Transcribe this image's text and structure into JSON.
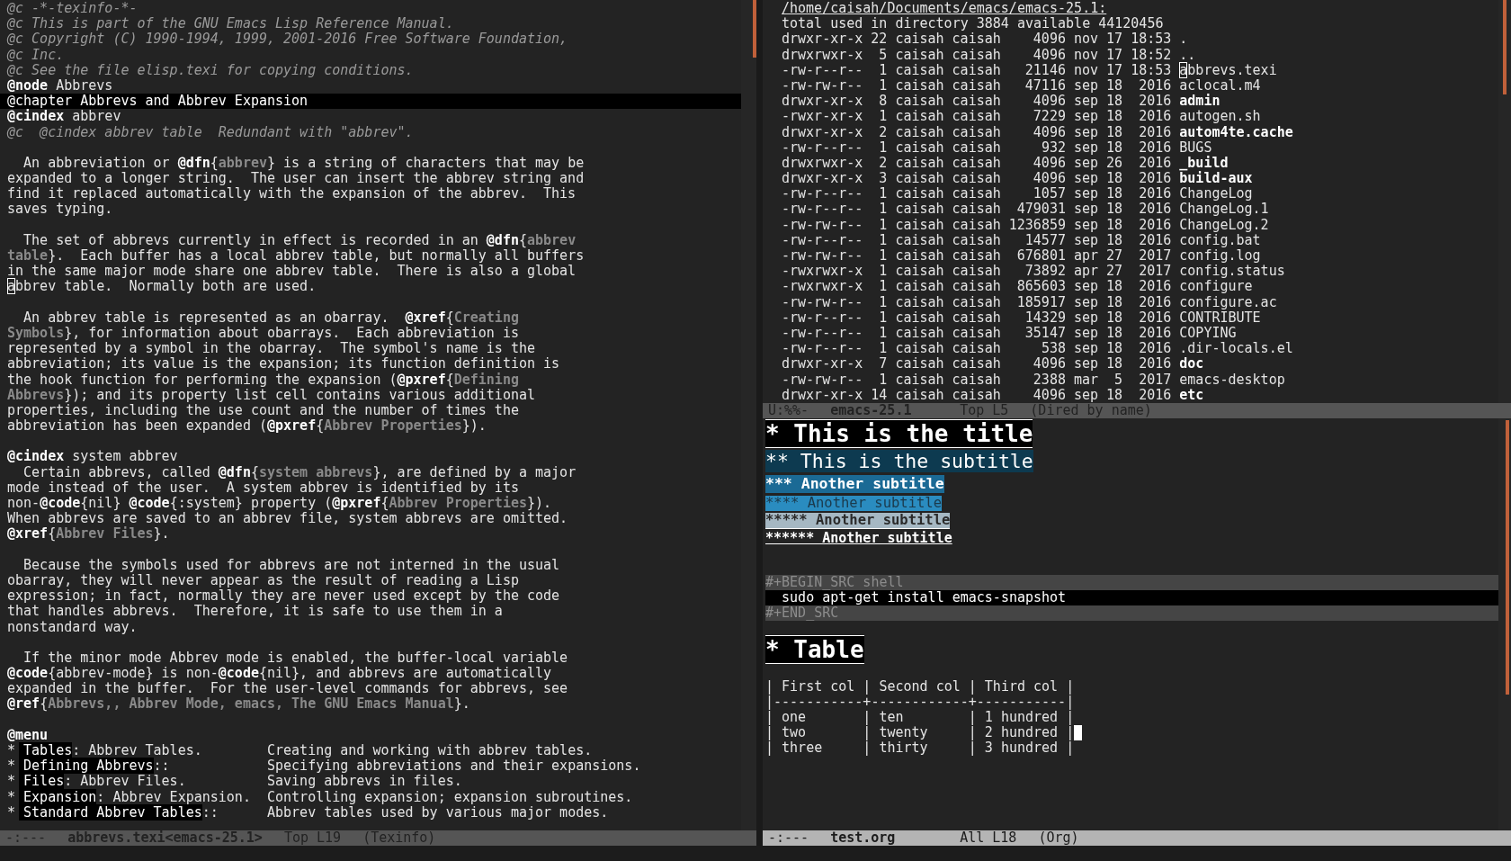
{
  "texinfo_buffer": {
    "blocks": [
      {
        "lines": [
          [
            {
              "kind": "comment",
              "text": "@c -*-texinfo-*-"
            }
          ],
          [
            {
              "kind": "comment",
              "text": "@c This is part of the GNU Emacs Lisp Reference Manual."
            }
          ],
          [
            {
              "kind": "comment",
              "text": "@c Copyright (C) 1990-1994, 1999, 2001-2016 Free Software Foundation,"
            }
          ],
          [
            {
              "kind": "comment",
              "text": "@c Inc."
            }
          ],
          [
            {
              "kind": "comment",
              "text": "@c See the file elisp.texi for copying conditions."
            }
          ],
          [
            {
              "kind": "keyword",
              "text": "@node"
            },
            {
              "kind": "text",
              "text": " Abbrevs"
            }
          ],
          [
            {
              "kind": "heading",
              "text": "@chapter Abbrevs and Abbrev Expansion"
            }
          ],
          [
            {
              "kind": "keyword",
              "text": "@cindex"
            },
            {
              "kind": "text",
              "text": " abbrev"
            }
          ],
          [
            {
              "kind": "comment",
              "text": "@c  @cindex abbrev table  Redundant with \"abbrev\"."
            }
          ]
        ]
      },
      {
        "lines": [
          [
            {
              "kind": "text",
              "text": "  An abbreviation or "
            },
            {
              "kind": "keyword",
              "text": "@dfn"
            },
            {
              "kind": "text",
              "text": "{"
            },
            {
              "kind": "ref",
              "text": "abbrev"
            },
            {
              "kind": "text",
              "text": "} is a string of characters that may be"
            }
          ],
          [
            {
              "kind": "text",
              "text": "expanded to a longer string.  The user can insert the abbrev string and"
            }
          ],
          [
            {
              "kind": "text",
              "text": "find it replaced automatically with the expansion of the abbrev.  This"
            }
          ],
          [
            {
              "kind": "text",
              "text": "saves typing."
            }
          ]
        ]
      },
      {
        "lines": [
          [
            {
              "kind": "text",
              "text": "  The set of abbrevs currently in effect is recorded in an "
            },
            {
              "kind": "keyword",
              "text": "@dfn"
            },
            {
              "kind": "text",
              "text": "{"
            },
            {
              "kind": "ref",
              "text": "abbrev"
            }
          ],
          [
            {
              "kind": "ref",
              "text": "table"
            },
            {
              "kind": "text",
              "text": "}.  Each buffer has a local abbrev table, but normally all buffers"
            }
          ],
          [
            {
              "kind": "text",
              "text": "in the same major mode share one abbrev table.  There is also a global"
            }
          ],
          [
            {
              "kind": "cursor",
              "text": "a"
            },
            {
              "kind": "text",
              "text": "bbrev table.  Normally both are used."
            }
          ]
        ]
      },
      {
        "lines": [
          [
            {
              "kind": "text",
              "text": "  An abbrev table is represented as an obarray.  "
            },
            {
              "kind": "keyword",
              "text": "@xref"
            },
            {
              "kind": "text",
              "text": "{"
            },
            {
              "kind": "ref",
              "text": "Creating"
            }
          ],
          [
            {
              "kind": "ref",
              "text": "Symbols"
            },
            {
              "kind": "text",
              "text": "}, for information about obarrays.  Each abbreviation is"
            }
          ],
          [
            {
              "kind": "text",
              "text": "represented by a symbol in the obarray.  The symbol's name is the"
            }
          ],
          [
            {
              "kind": "text",
              "text": "abbreviation; its value is the expansion; its function definition is"
            }
          ],
          [
            {
              "kind": "text",
              "text": "the hook function for performing the expansion ("
            },
            {
              "kind": "keyword",
              "text": "@pxref"
            },
            {
              "kind": "text",
              "text": "{"
            },
            {
              "kind": "ref",
              "text": "Defining"
            }
          ],
          [
            {
              "kind": "ref",
              "text": "Abbrevs"
            },
            {
              "kind": "text",
              "text": "}); and its property list cell contains various additional"
            }
          ],
          [
            {
              "kind": "text",
              "text": "properties, including the use count and the number of times the"
            }
          ],
          [
            {
              "kind": "text",
              "text": "abbreviation has been expanded ("
            },
            {
              "kind": "keyword",
              "text": "@pxref"
            },
            {
              "kind": "text",
              "text": "{"
            },
            {
              "kind": "ref",
              "text": "Abbrev Properties"
            },
            {
              "kind": "text",
              "text": "})."
            }
          ]
        ]
      },
      {
        "lines": [
          [
            {
              "kind": "keyword",
              "text": "@cindex"
            },
            {
              "kind": "text",
              "text": " system abbrev"
            }
          ],
          [
            {
              "kind": "text",
              "text": "  Certain abbrevs, called "
            },
            {
              "kind": "keyword",
              "text": "@dfn"
            },
            {
              "kind": "text",
              "text": "{"
            },
            {
              "kind": "ref",
              "text": "system abbrevs"
            },
            {
              "kind": "text",
              "text": "}, are defined by a major"
            }
          ],
          [
            {
              "kind": "text",
              "text": "mode instead of the user.  A system abbrev is identified by its"
            }
          ],
          [
            {
              "kind": "text",
              "text": "non-"
            },
            {
              "kind": "keyword",
              "text": "@code"
            },
            {
              "kind": "text",
              "text": "{nil} "
            },
            {
              "kind": "keyword",
              "text": "@code"
            },
            {
              "kind": "text",
              "text": "{:system} property ("
            },
            {
              "kind": "keyword",
              "text": "@pxref"
            },
            {
              "kind": "text",
              "text": "{"
            },
            {
              "kind": "ref",
              "text": "Abbrev Properties"
            },
            {
              "kind": "text",
              "text": "})."
            }
          ],
          [
            {
              "kind": "text",
              "text": "When abbrevs are saved to an abbrev file, system abbrevs are omitted."
            }
          ],
          [
            {
              "kind": "keyword",
              "text": "@xref"
            },
            {
              "kind": "text",
              "text": "{"
            },
            {
              "kind": "ref",
              "text": "Abbrev Files"
            },
            {
              "kind": "text",
              "text": "}."
            }
          ]
        ]
      },
      {
        "lines": [
          [
            {
              "kind": "text",
              "text": "  Because the symbols used for abbrevs are not interned in the usual"
            }
          ],
          [
            {
              "kind": "text",
              "text": "obarray, they will never appear as the result of reading a Lisp"
            }
          ],
          [
            {
              "kind": "text",
              "text": "expression; in fact, normally they are never used except by the code"
            }
          ],
          [
            {
              "kind": "text",
              "text": "that handles abbrevs.  Therefore, it is safe to use them in a"
            }
          ],
          [
            {
              "kind": "text",
              "text": "nonstandard way."
            }
          ]
        ]
      },
      {
        "lines": [
          [
            {
              "kind": "text",
              "text": "  If the minor mode Abbrev mode is enabled, the buffer-local variable"
            }
          ],
          [
            {
              "kind": "keyword",
              "text": "@code"
            },
            {
              "kind": "text",
              "text": "{abbrev-mode} is non-"
            },
            {
              "kind": "keyword",
              "text": "@code"
            },
            {
              "kind": "text",
              "text": "{nil}, and abbrevs are automatically"
            }
          ],
          [
            {
              "kind": "text",
              "text": "expanded in the buffer.  For the user-level commands for abbrevs, see"
            }
          ],
          [
            {
              "kind": "keyword",
              "text": "@ref"
            },
            {
              "kind": "text",
              "text": "{"
            },
            {
              "kind": "ref",
              "text": "Abbrevs,, Abbrev Mode, emacs, The GNU Emacs Manual"
            },
            {
              "kind": "text",
              "text": "}."
            }
          ]
        ]
      },
      {
        "lines": [
          [
            {
              "kind": "keyword",
              "text": "@menu"
            }
          ],
          [
            {
              "kind": "text",
              "text": "* "
            },
            {
              "kind": "menu-node",
              "text": "Tables"
            },
            {
              "kind": "text",
              "text": ": Abbrev Tables.        Creating and working with abbrev tables."
            }
          ],
          [
            {
              "kind": "text",
              "text": "* "
            },
            {
              "kind": "menu-node",
              "text": "Defining Abbrevs"
            },
            {
              "kind": "text",
              "text": "::            Specifying abbreviations and their expansions."
            }
          ],
          [
            {
              "kind": "text",
              "text": "* "
            },
            {
              "kind": "menu-node",
              "text": "Files"
            },
            {
              "kind": "text",
              "text": ": Abbrev Files.          Saving abbrevs in files."
            }
          ],
          [
            {
              "kind": "text",
              "text": "* "
            },
            {
              "kind": "menu-node",
              "text": "Expansion"
            },
            {
              "kind": "text",
              "text": ": Abbrev Expansion.  Controlling expansion; expansion subroutines."
            }
          ],
          [
            {
              "kind": "text",
              "text": "* "
            },
            {
              "kind": "menu-node",
              "text": "Standard Abbrev Tables"
            },
            {
              "kind": "text",
              "text": "::      Abbrev tables used by various major modes."
            }
          ]
        ]
      }
    ],
    "mode_line": {
      "active": false,
      "status": "-:---",
      "buffer": "abbrevs.texi<emacs-25.1>",
      "position": "Top L19",
      "mode": "(Texinfo)"
    }
  },
  "dired_buffer": {
    "header": "/home/caisah/Documents/emacs/emacs-25.1:",
    "total": "total used in directory 3884 available 44120456",
    "rows": [
      {
        "perms": "drwxr-xr-x",
        "links": "22",
        "owner": "caisah",
        "group": "caisah",
        "size": "4096",
        "month": "nov",
        "day": "17",
        "time": "18:53",
        "name": ".",
        "kind": "link",
        "cursor": false
      },
      {
        "perms": "drwxrwxr-x",
        "links": "5",
        "owner": "caisah",
        "group": "caisah",
        "size": "4096",
        "month": "nov",
        "day": "17",
        "time": "18:52",
        "name": "..",
        "kind": "link",
        "cursor": false
      },
      {
        "perms": "-rw-r--r--",
        "links": "1",
        "owner": "caisah",
        "group": "caisah",
        "size": "21146",
        "month": "nov",
        "day": "17",
        "time": "18:53",
        "name": "abbrevs.texi",
        "kind": "file",
        "cursor": true
      },
      {
        "perms": "-rw-rw-r--",
        "links": "1",
        "owner": "caisah",
        "group": "caisah",
        "size": "47116",
        "month": "sep",
        "day": "18",
        "time": "2016",
        "name": "aclocal.m4",
        "kind": "file",
        "cursor": false
      },
      {
        "perms": "drwxr-xr-x",
        "links": "8",
        "owner": "caisah",
        "group": "caisah",
        "size": "4096",
        "month": "sep",
        "day": "18",
        "time": "2016",
        "name": "admin",
        "kind": "dir",
        "cursor": false
      },
      {
        "perms": "-rwxr-xr-x",
        "links": "1",
        "owner": "caisah",
        "group": "caisah",
        "size": "7229",
        "month": "sep",
        "day": "18",
        "time": "2016",
        "name": "autogen.sh",
        "kind": "file",
        "cursor": false
      },
      {
        "perms": "drwxr-xr-x",
        "links": "2",
        "owner": "caisah",
        "group": "caisah",
        "size": "4096",
        "month": "sep",
        "day": "18",
        "time": "2016",
        "name": "autom4te.cache",
        "kind": "dir",
        "cursor": false
      },
      {
        "perms": "-rw-r--r--",
        "links": "1",
        "owner": "caisah",
        "group": "caisah",
        "size": "932",
        "month": "sep",
        "day": "18",
        "time": "2016",
        "name": "BUGS",
        "kind": "file",
        "cursor": false
      },
      {
        "perms": "drwxrwxr-x",
        "links": "2",
        "owner": "caisah",
        "group": "caisah",
        "size": "4096",
        "month": "sep",
        "day": "26",
        "time": "2016",
        "name": "_build",
        "kind": "dir",
        "cursor": false
      },
      {
        "perms": "drwxr-xr-x",
        "links": "3",
        "owner": "caisah",
        "group": "caisah",
        "size": "4096",
        "month": "sep",
        "day": "18",
        "time": "2016",
        "name": "build-aux",
        "kind": "dir",
        "cursor": false
      },
      {
        "perms": "-rw-r--r--",
        "links": "1",
        "owner": "caisah",
        "group": "caisah",
        "size": "1057",
        "month": "sep",
        "day": "18",
        "time": "2016",
        "name": "ChangeLog",
        "kind": "file",
        "cursor": false
      },
      {
        "perms": "-rw-r--r--",
        "links": "1",
        "owner": "caisah",
        "group": "caisah",
        "size": "479031",
        "month": "sep",
        "day": "18",
        "time": "2016",
        "name": "ChangeLog.1",
        "kind": "file",
        "cursor": false
      },
      {
        "perms": "-rw-rw-r--",
        "links": "1",
        "owner": "caisah",
        "group": "caisah",
        "size": "1236859",
        "month": "sep",
        "day": "18",
        "time": "2016",
        "name": "ChangeLog.2",
        "kind": "file",
        "cursor": false
      },
      {
        "perms": "-rw-r--r--",
        "links": "1",
        "owner": "caisah",
        "group": "caisah",
        "size": "14577",
        "month": "sep",
        "day": "18",
        "time": "2016",
        "name": "config.bat",
        "kind": "file",
        "cursor": false
      },
      {
        "perms": "-rw-rw-r--",
        "links": "1",
        "owner": "caisah",
        "group": "caisah",
        "size": "676801",
        "month": "apr",
        "day": "27",
        "time": "2017",
        "name": "config.log",
        "kind": "file",
        "cursor": false
      },
      {
        "perms": "-rwxrwxr-x",
        "links": "1",
        "owner": "caisah",
        "group": "caisah",
        "size": "73892",
        "month": "apr",
        "day": "27",
        "time": "2017",
        "name": "config.status",
        "kind": "file",
        "cursor": false
      },
      {
        "perms": "-rwxrwxr-x",
        "links": "1",
        "owner": "caisah",
        "group": "caisah",
        "size": "865603",
        "month": "sep",
        "day": "18",
        "time": "2016",
        "name": "configure",
        "kind": "file",
        "cursor": false
      },
      {
        "perms": "-rw-rw-r--",
        "links": "1",
        "owner": "caisah",
        "group": "caisah",
        "size": "185917",
        "month": "sep",
        "day": "18",
        "time": "2016",
        "name": "configure.ac",
        "kind": "file",
        "cursor": false
      },
      {
        "perms": "-rw-r--r--",
        "links": "1",
        "owner": "caisah",
        "group": "caisah",
        "size": "14329",
        "month": "sep",
        "day": "18",
        "time": "2016",
        "name": "CONTRIBUTE",
        "kind": "file",
        "cursor": false
      },
      {
        "perms": "-rw-r--r--",
        "links": "1",
        "owner": "caisah",
        "group": "caisah",
        "size": "35147",
        "month": "sep",
        "day": "18",
        "time": "2016",
        "name": "COPYING",
        "kind": "file",
        "cursor": false
      },
      {
        "perms": "-rw-r--r--",
        "links": "1",
        "owner": "caisah",
        "group": "caisah",
        "size": "538",
        "month": "sep",
        "day": "18",
        "time": "2016",
        "name": ".dir-locals.el",
        "kind": "file",
        "cursor": false
      },
      {
        "perms": "drwxr-xr-x",
        "links": "7",
        "owner": "caisah",
        "group": "caisah",
        "size": "4096",
        "month": "sep",
        "day": "18",
        "time": "2016",
        "name": "doc",
        "kind": "dir",
        "cursor": false
      },
      {
        "perms": "-rw-rw-r--",
        "links": "1",
        "owner": "caisah",
        "group": "caisah",
        "size": "2388",
        "month": "mar",
        "day": "5",
        "time": "2017",
        "name": "emacs-desktop",
        "kind": "file",
        "cursor": false
      },
      {
        "perms": "drwxr-xr-x",
        "links": "14",
        "owner": "caisah",
        "group": "caisah",
        "size": "4096",
        "month": "sep",
        "day": "18",
        "time": "2016",
        "name": "etc",
        "kind": "dir",
        "cursor": false
      }
    ],
    "mode_line": {
      "active": false,
      "status": "U:%%-",
      "buffer": "emacs-25.1",
      "position": "Top L5",
      "mode": "(Dired by name)"
    }
  },
  "org_buffer": {
    "headings": [
      {
        "text": "* This is the title",
        "children": [
          {
            "text": "** This is the subtitle",
            "children": [
              {
                "text": "*** Another subtitle",
                "children": [
                  {
                    "text": "**** Another subtitle",
                    "children": [
                      {
                        "text": "***** Another subtitle",
                        "children": [
                          {
                            "text": "****** Another subtitle",
                            "src_block": {
                              "begin": "#+BEGIN_SRC shell",
                              "code": "  sudo apt-get install emacs-snapshot",
                              "end": "#+END_SRC"
                            }
                          }
                        ]
                      }
                    ]
                  }
                ]
              }
            ]
          }
        ]
      },
      {
        "text": "* Table",
        "table": {
          "header": "| First col | Second col | Third col |",
          "rule": "|-----------+------------+-----------|",
          "rows": [
            {
              "text": "| one       | ten        | 1 hundred |",
              "cursor": false
            },
            {
              "text": "| two       | twenty     | 2 hundred |",
              "cursor": true
            },
            {
              "text": "| three     | thirty     | 3 hundred |",
              "cursor": false
            }
          ]
        }
      }
    ],
    "mode_line": {
      "active": true,
      "status": "-:---",
      "buffer": "test.org",
      "position": "All L18",
      "mode": "(Org)"
    }
  }
}
